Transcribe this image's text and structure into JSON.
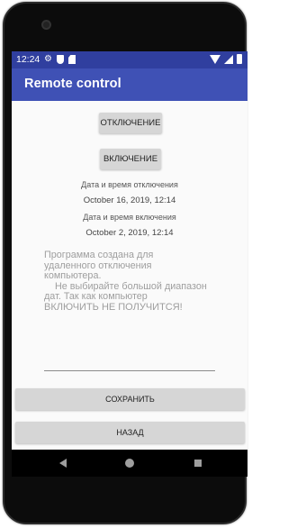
{
  "status_bar": {
    "time": "12:24",
    "icons_left": [
      "settings-icon",
      "shield-icon",
      "sd-card-icon"
    ],
    "icons_right": [
      "wifi-icon",
      "signal-icon",
      "battery-icon"
    ]
  },
  "app_bar": {
    "title": "Remote control"
  },
  "controls": {
    "off_button": "ОТКЛЮЧЕНИЕ",
    "on_button": "ВКЛЮЧЕНИЕ"
  },
  "schedule": {
    "off_title": "Дата и время отключения",
    "off_value": "October 16, 2019, 12:14",
    "on_title": "Дата и время включения",
    "on_value": "October 2, 2019, 12:14"
  },
  "info": {
    "line1": "Программа создана для",
    "line2": "удаленного отключения",
    "line3": "компьютера.",
    "line4": "    Не выбирайте большой диапазон",
    "line5": "дат. Так как компьютер",
    "line6": "ВКЛЮЧИТЬ НЕ ПОЛУЧИТСЯ!"
  },
  "input": {
    "placeholder": ""
  },
  "actions": {
    "save_button": "СОХРАНИТЬ",
    "back_button": "НАЗАД"
  },
  "colors": {
    "status_bar": "#303f9f",
    "app_bar": "#3f51b5",
    "button_bg": "#d6d6d6"
  }
}
